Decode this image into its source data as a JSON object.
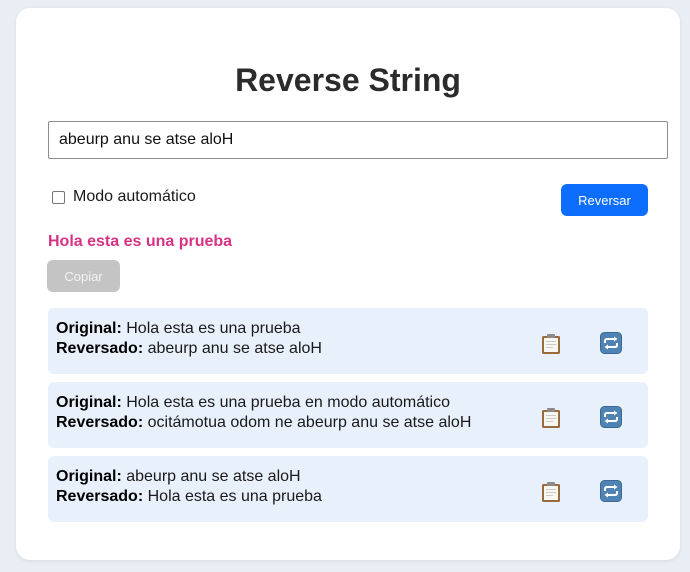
{
  "app": {
    "title": "Reverse String"
  },
  "input": {
    "value": "abeurp anu se atse aloH"
  },
  "controls": {
    "auto_mode_label": "Modo automático",
    "auto_mode_checked": false,
    "reverse_label": "Reversar",
    "copy_label": "Copiar"
  },
  "result": {
    "text": "Hola esta es una prueba"
  },
  "labels": {
    "original": "Original:",
    "reversed": "Reversado:"
  },
  "history": [
    {
      "original": "Hola esta es una prueba",
      "reversed": "abeurp anu se atse aloH"
    },
    {
      "original": "Hola esta es una prueba en modo automático",
      "reversed": "ocitámotua odom ne abeurp anu se atse aloH"
    },
    {
      "original": "abeurp anu se atse aloH",
      "reversed": "Hola esta es una prueba"
    }
  ],
  "icons": {
    "copy": "clipboard-icon",
    "reuse": "repeat-icon"
  },
  "colors": {
    "primary": "#0d6efd",
    "result": "#d63384",
    "history_bg": "#e8f0fb",
    "disabled": "#c4c4c4"
  }
}
